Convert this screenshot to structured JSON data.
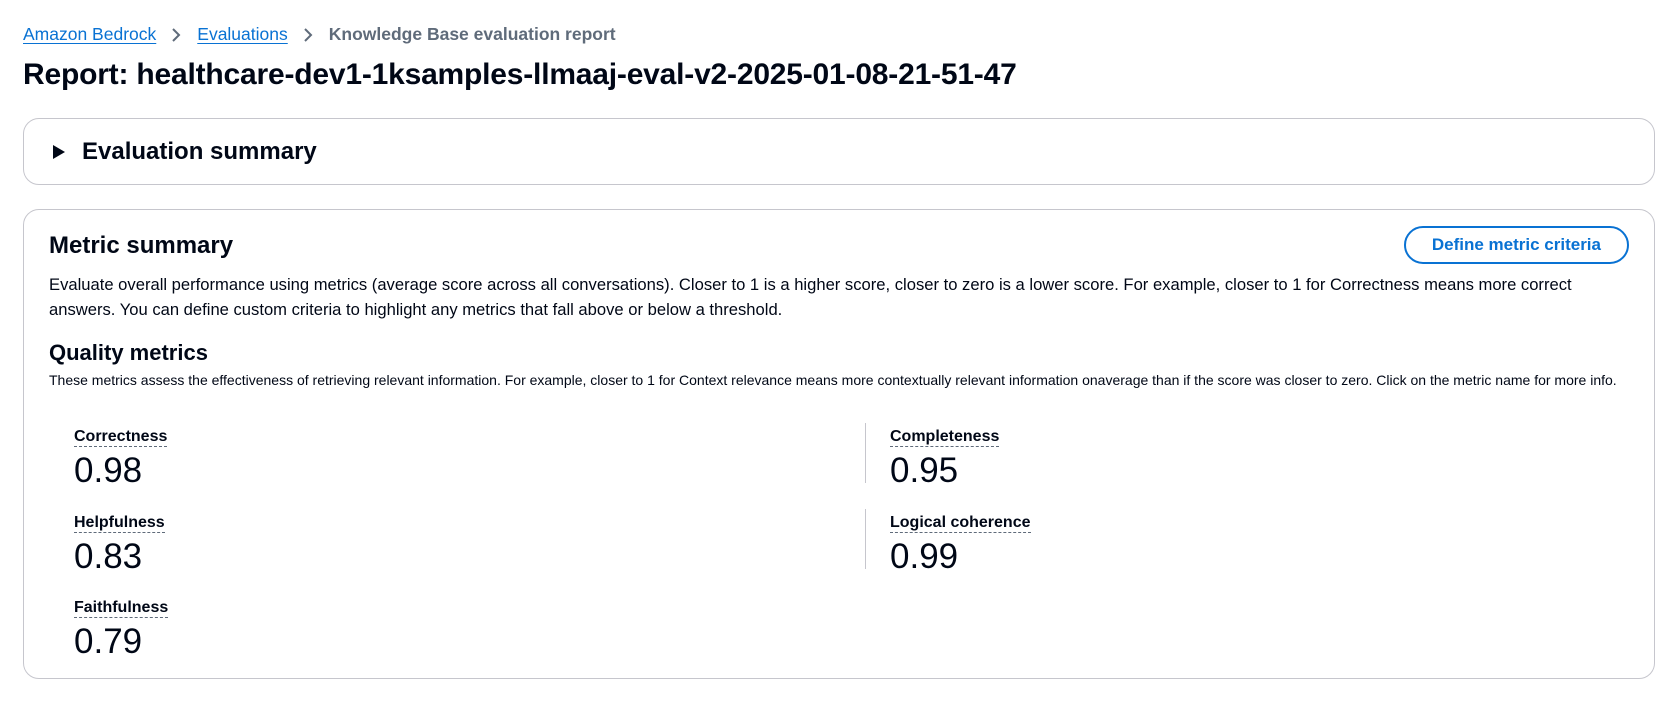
{
  "breadcrumb": {
    "items": [
      {
        "label": "Amazon Bedrock"
      },
      {
        "label": "Evaluations"
      },
      {
        "label": "Knowledge Base evaluation report"
      }
    ]
  },
  "page": {
    "title": "Report: healthcare-dev1-1ksamples-llmaaj-eval-v2-2025-01-08-21-51-47"
  },
  "evaluation_summary": {
    "title": "Evaluation summary",
    "expanded": false,
    "icon": "caret-right-icon"
  },
  "metric_summary": {
    "title": "Metric summary",
    "define_button_label": "Define metric criteria",
    "description": "Evaluate overall performance using metrics (average score across all conversations). Closer to 1 is a higher score, closer to zero is a lower score. For example, closer to 1 for Correctness means more correct answers. You can define custom criteria to highlight any metrics that fall above or below a threshold."
  },
  "quality_metrics": {
    "title": "Quality metrics",
    "description": "These metrics assess the effectiveness of retrieving relevant information. For example, closer to 1 for Context relevance means more contextually relevant information onaverage than if the score was closer to zero. Click on the metric name for more info.",
    "metrics": [
      {
        "name": "Correctness",
        "value": "0.98"
      },
      {
        "name": "Completeness",
        "value": "0.95"
      },
      {
        "name": "Helpfulness",
        "value": "0.83"
      },
      {
        "name": "Logical coherence",
        "value": "0.99"
      },
      {
        "name": "Faithfulness",
        "value": "0.79"
      }
    ]
  },
  "colors": {
    "link": "#0972d3",
    "text": "#000716",
    "muted": "#5f6b7a",
    "border": "#c6c6cd"
  }
}
